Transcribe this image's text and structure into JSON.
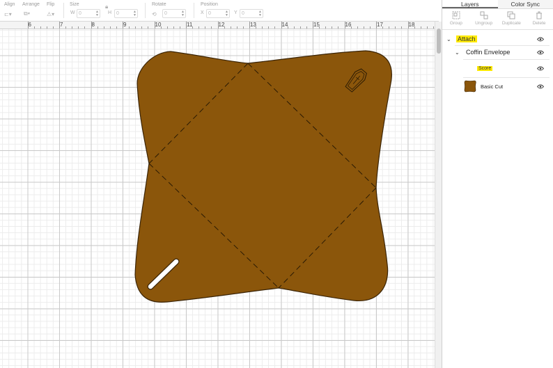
{
  "toolbar": {
    "align_label": "Align",
    "arrange_label": "Arrange",
    "flip_label": "Flip",
    "size_label": "Size",
    "width_prefix": "W",
    "width_value": "0",
    "height_prefix": "H",
    "height_value": "0",
    "rotate_label": "Rotate",
    "rotate_value": "0",
    "position_label": "Position",
    "x_prefix": "X",
    "x_value": "0",
    "y_prefix": "Y",
    "y_value": "0"
  },
  "ruler": {
    "ticks": [
      "6",
      "7",
      "8",
      "9",
      "10",
      "11",
      "12",
      "13",
      "14",
      "15",
      "16",
      "17",
      "18"
    ]
  },
  "canvas": {
    "shape_color": "#8B560B",
    "outline_color": "#3a2305"
  },
  "panel": {
    "tabs": [
      {
        "label": "Layers",
        "active": true
      },
      {
        "label": "Color Sync",
        "active": false
      }
    ],
    "tools": [
      {
        "label": "Group",
        "icon": "group-icon"
      },
      {
        "label": "Ungroup",
        "icon": "ungroup-icon"
      },
      {
        "label": "Duplicate",
        "icon": "duplicate-icon"
      },
      {
        "label": "Delete",
        "icon": "trash-icon"
      }
    ],
    "layers": {
      "attach": "Attach",
      "group": "Coffin Envelope",
      "score": "Score",
      "cut": "Basic Cut"
    },
    "highlight_color": "#ffea00"
  }
}
